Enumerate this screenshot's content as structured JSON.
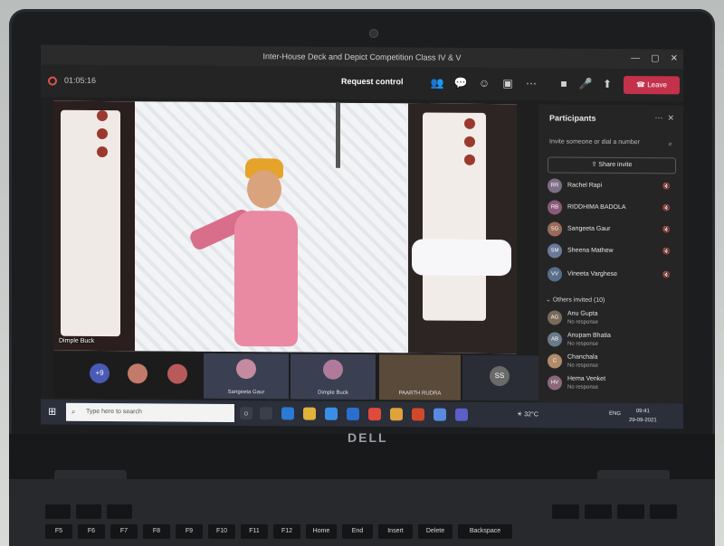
{
  "window": {
    "title": "Inter-House Deck and Depict Competition Class IV & V"
  },
  "toolbar": {
    "timer": "01:05:16",
    "request_control": "Request control",
    "leave": "Leave"
  },
  "video": {
    "name": "Dimple Buck"
  },
  "participants": {
    "title": "Participants",
    "invite_placeholder": "Invite someone or dial a number",
    "share_invite": "Share invite",
    "list": [
      {
        "name": "Rachel Rapi",
        "initials": "RR"
      },
      {
        "name": "RIDDHIMA BADOLA",
        "initials": "RB"
      },
      {
        "name": "Sangeeta Gaur",
        "initials": "SG"
      },
      {
        "name": "Sheena Mathew",
        "initials": "SM"
      },
      {
        "name": "Vineeta Varghese",
        "initials": "VV"
      }
    ],
    "others_header": "Others invited (10)",
    "others": [
      {
        "name": "Anu Gupta",
        "status": "No response",
        "initials": "AG"
      },
      {
        "name": "Anupam Bhatia",
        "status": "No response",
        "initials": "AB"
      },
      {
        "name": "Chanchala",
        "status": "No response",
        "initials": "C"
      },
      {
        "name": "Hema Venket",
        "status": "No response",
        "initials": "HV"
      }
    ]
  },
  "gallery": {
    "more_count": "+9",
    "tiles": [
      {
        "name": "Sangeeta Gaur"
      },
      {
        "name": "Dimple Buck"
      },
      {
        "name": "PAARTH RUDRA"
      },
      {
        "name": "",
        "initials": "SS"
      }
    ]
  },
  "taskbar": {
    "search_placeholder": "Type here to search",
    "weather": "32°C",
    "lang": "ENG",
    "time": "09:41",
    "date": "29-09-2021"
  },
  "laptop": {
    "brand": "DELL"
  },
  "keyboard": {
    "keys": [
      "F5",
      "F6",
      "F7",
      "F8",
      "F9",
      "F10",
      "F11",
      "F12",
      "Home",
      "End",
      "Insert",
      "Delete",
      "Backspace"
    ]
  }
}
